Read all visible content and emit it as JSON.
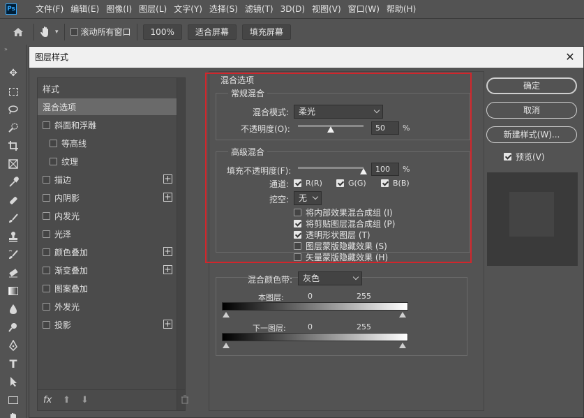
{
  "app": {
    "logo": "Ps"
  },
  "menu": [
    "文件(F)",
    "编辑(E)",
    "图像(I)",
    "图层(L)",
    "文字(Y)",
    "选择(S)",
    "滤镜(T)",
    "3D(D)",
    "视图(V)",
    "窗口(W)",
    "帮助(H)"
  ],
  "options": {
    "home_icon": "home-icon",
    "hand_icon": "hand-icon",
    "scroll_all": {
      "label": "滚动所有窗口",
      "checked": false
    },
    "zoom_100": "100%",
    "fit_screen": "适合屏幕",
    "fill_screen": "填充屏幕"
  },
  "toolbar": [
    "move-icon",
    "marquee-icon",
    "lasso-icon",
    "quick-select-icon",
    "crop-icon",
    "frame-icon",
    "eyedropper-icon",
    "healing-icon",
    "brush-icon",
    "stamp-icon",
    "history-brush-icon",
    "eraser-icon",
    "gradient-icon",
    "blur-icon",
    "dodge-icon",
    "pen-icon",
    "type-icon",
    "path-select-icon",
    "rectangle-icon",
    "hand-icon"
  ],
  "dialog": {
    "title": "图层样式",
    "close": "✕",
    "style_list": {
      "header": "样式",
      "items": [
        {
          "label": "混合选项",
          "checkbox": false,
          "selected": true,
          "plus": false,
          "indent": 0
        },
        {
          "label": "斜面和浮雕",
          "checkbox": true,
          "plus": false,
          "indent": 0
        },
        {
          "label": "等高线",
          "checkbox": true,
          "plus": false,
          "indent": 1
        },
        {
          "label": "纹理",
          "checkbox": true,
          "plus": false,
          "indent": 1
        },
        {
          "label": "描边",
          "checkbox": true,
          "plus": true,
          "indent": 0
        },
        {
          "label": "内阴影",
          "checkbox": true,
          "plus": true,
          "indent": 0
        },
        {
          "label": "内发光",
          "checkbox": true,
          "plus": false,
          "indent": 0
        },
        {
          "label": "光泽",
          "checkbox": true,
          "plus": false,
          "indent": 0
        },
        {
          "label": "颜色叠加",
          "checkbox": true,
          "plus": true,
          "indent": 0
        },
        {
          "label": "渐变叠加",
          "checkbox": true,
          "plus": true,
          "indent": 0
        },
        {
          "label": "图案叠加",
          "checkbox": true,
          "plus": false,
          "indent": 0
        },
        {
          "label": "外发光",
          "checkbox": true,
          "plus": false,
          "indent": 0
        },
        {
          "label": "投影",
          "checkbox": true,
          "plus": true,
          "indent": 0
        }
      ],
      "footer": {
        "fx": "fx"
      }
    },
    "blend_options": {
      "title": "混合选项",
      "general": {
        "title": "常规混合",
        "blend_mode_label": "混合模式:",
        "blend_mode_value": "柔光",
        "opacity_label": "不透明度(O):",
        "opacity_value": "50",
        "opacity_unit": "%",
        "opacity_level": 0.5
      },
      "advanced": {
        "title": "高级混合",
        "fill_label": "填充不透明度(F):",
        "fill_value": "100",
        "fill_unit": "%",
        "fill_level": 1.0,
        "channels_label": "通道:",
        "channel_r": "R(R)",
        "channel_g": "G(G)",
        "channel_b": "B(B)",
        "knockout_label": "挖空:",
        "knockout_value": "无",
        "options": [
          {
            "label": "将内部效果混合成组 (I)",
            "checked": false
          },
          {
            "label": "将剪贴图层混合成组 (P)",
            "checked": true
          },
          {
            "label": "透明形状图层 (T)",
            "checked": true
          },
          {
            "label": "图层蒙版隐藏效果 (S)",
            "checked": false
          },
          {
            "label": "矢量蒙版隐藏效果 (H)",
            "checked": false
          }
        ]
      },
      "blend_if": {
        "label": "混合颜色带:",
        "value": "灰色",
        "this_layer": "本图层:",
        "underlying": "下一图层:",
        "min": "0",
        "max": "255"
      }
    },
    "buttons": {
      "ok": "确定",
      "cancel": "取消",
      "new_style": "新建样式(W)...",
      "preview": "预览(V)"
    }
  }
}
